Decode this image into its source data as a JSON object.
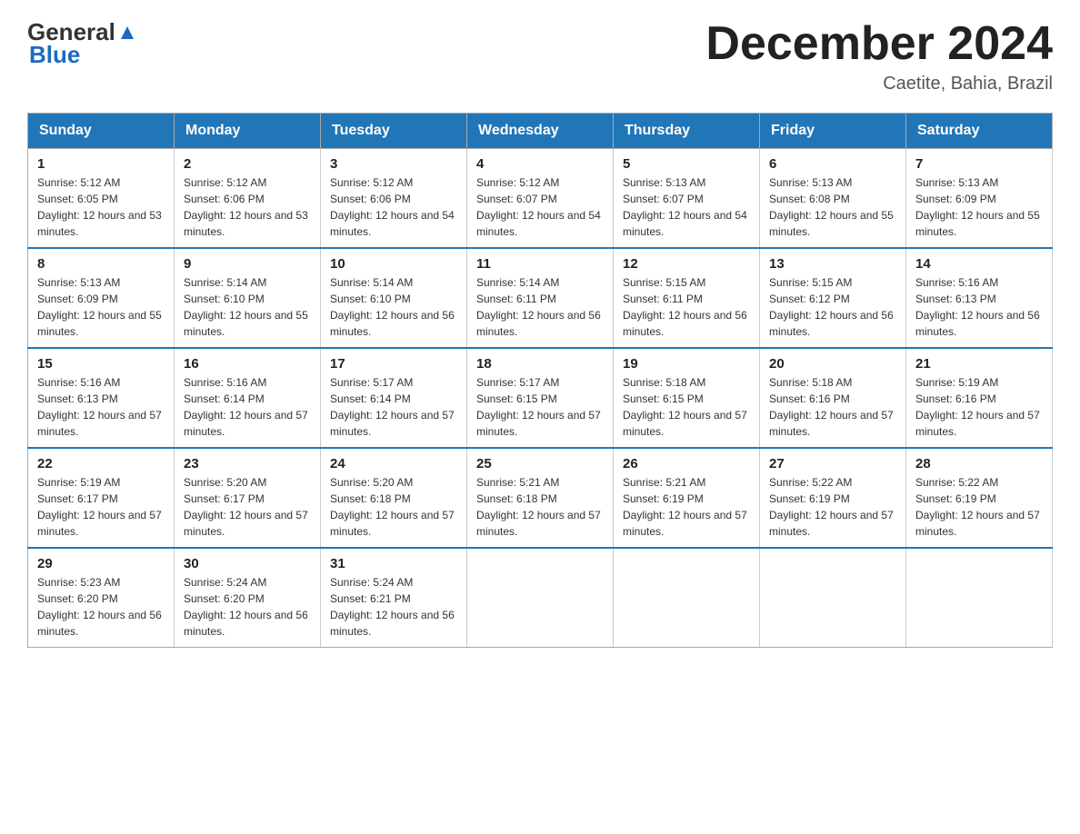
{
  "logo": {
    "general": "General",
    "blue": "Blue"
  },
  "title": "December 2024",
  "subtitle": "Caetite, Bahia, Brazil",
  "headers": [
    "Sunday",
    "Monday",
    "Tuesday",
    "Wednesday",
    "Thursday",
    "Friday",
    "Saturday"
  ],
  "weeks": [
    [
      {
        "day": "1",
        "sunrise": "5:12 AM",
        "sunset": "6:05 PM",
        "daylight": "12 hours and 53 minutes."
      },
      {
        "day": "2",
        "sunrise": "5:12 AM",
        "sunset": "6:06 PM",
        "daylight": "12 hours and 53 minutes."
      },
      {
        "day": "3",
        "sunrise": "5:12 AM",
        "sunset": "6:06 PM",
        "daylight": "12 hours and 54 minutes."
      },
      {
        "day": "4",
        "sunrise": "5:12 AM",
        "sunset": "6:07 PM",
        "daylight": "12 hours and 54 minutes."
      },
      {
        "day": "5",
        "sunrise": "5:13 AM",
        "sunset": "6:07 PM",
        "daylight": "12 hours and 54 minutes."
      },
      {
        "day": "6",
        "sunrise": "5:13 AM",
        "sunset": "6:08 PM",
        "daylight": "12 hours and 55 minutes."
      },
      {
        "day": "7",
        "sunrise": "5:13 AM",
        "sunset": "6:09 PM",
        "daylight": "12 hours and 55 minutes."
      }
    ],
    [
      {
        "day": "8",
        "sunrise": "5:13 AM",
        "sunset": "6:09 PM",
        "daylight": "12 hours and 55 minutes."
      },
      {
        "day": "9",
        "sunrise": "5:14 AM",
        "sunset": "6:10 PM",
        "daylight": "12 hours and 55 minutes."
      },
      {
        "day": "10",
        "sunrise": "5:14 AM",
        "sunset": "6:10 PM",
        "daylight": "12 hours and 56 minutes."
      },
      {
        "day": "11",
        "sunrise": "5:14 AM",
        "sunset": "6:11 PM",
        "daylight": "12 hours and 56 minutes."
      },
      {
        "day": "12",
        "sunrise": "5:15 AM",
        "sunset": "6:11 PM",
        "daylight": "12 hours and 56 minutes."
      },
      {
        "day": "13",
        "sunrise": "5:15 AM",
        "sunset": "6:12 PM",
        "daylight": "12 hours and 56 minutes."
      },
      {
        "day": "14",
        "sunrise": "5:16 AM",
        "sunset": "6:13 PM",
        "daylight": "12 hours and 56 minutes."
      }
    ],
    [
      {
        "day": "15",
        "sunrise": "5:16 AM",
        "sunset": "6:13 PM",
        "daylight": "12 hours and 57 minutes."
      },
      {
        "day": "16",
        "sunrise": "5:16 AM",
        "sunset": "6:14 PM",
        "daylight": "12 hours and 57 minutes."
      },
      {
        "day": "17",
        "sunrise": "5:17 AM",
        "sunset": "6:14 PM",
        "daylight": "12 hours and 57 minutes."
      },
      {
        "day": "18",
        "sunrise": "5:17 AM",
        "sunset": "6:15 PM",
        "daylight": "12 hours and 57 minutes."
      },
      {
        "day": "19",
        "sunrise": "5:18 AM",
        "sunset": "6:15 PM",
        "daylight": "12 hours and 57 minutes."
      },
      {
        "day": "20",
        "sunrise": "5:18 AM",
        "sunset": "6:16 PM",
        "daylight": "12 hours and 57 minutes."
      },
      {
        "day": "21",
        "sunrise": "5:19 AM",
        "sunset": "6:16 PM",
        "daylight": "12 hours and 57 minutes."
      }
    ],
    [
      {
        "day": "22",
        "sunrise": "5:19 AM",
        "sunset": "6:17 PM",
        "daylight": "12 hours and 57 minutes."
      },
      {
        "day": "23",
        "sunrise": "5:20 AM",
        "sunset": "6:17 PM",
        "daylight": "12 hours and 57 minutes."
      },
      {
        "day": "24",
        "sunrise": "5:20 AM",
        "sunset": "6:18 PM",
        "daylight": "12 hours and 57 minutes."
      },
      {
        "day": "25",
        "sunrise": "5:21 AM",
        "sunset": "6:18 PM",
        "daylight": "12 hours and 57 minutes."
      },
      {
        "day": "26",
        "sunrise": "5:21 AM",
        "sunset": "6:19 PM",
        "daylight": "12 hours and 57 minutes."
      },
      {
        "day": "27",
        "sunrise": "5:22 AM",
        "sunset": "6:19 PM",
        "daylight": "12 hours and 57 minutes."
      },
      {
        "day": "28",
        "sunrise": "5:22 AM",
        "sunset": "6:19 PM",
        "daylight": "12 hours and 57 minutes."
      }
    ],
    [
      {
        "day": "29",
        "sunrise": "5:23 AM",
        "sunset": "6:20 PM",
        "daylight": "12 hours and 56 minutes."
      },
      {
        "day": "30",
        "sunrise": "5:24 AM",
        "sunset": "6:20 PM",
        "daylight": "12 hours and 56 minutes."
      },
      {
        "day": "31",
        "sunrise": "5:24 AM",
        "sunset": "6:21 PM",
        "daylight": "12 hours and 56 minutes."
      },
      null,
      null,
      null,
      null
    ]
  ]
}
